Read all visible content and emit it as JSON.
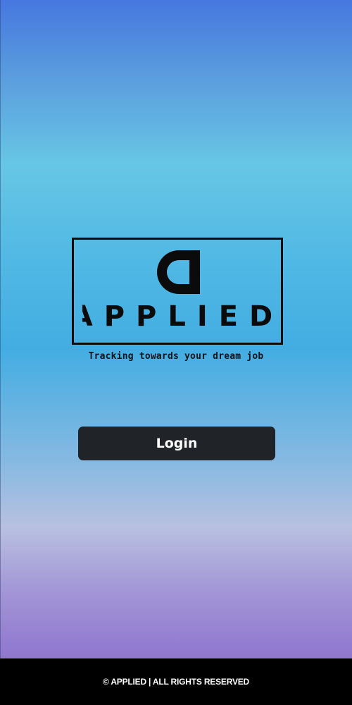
{
  "brand": {
    "name": "APPLIED",
    "tagline": "Tracking towards your dream job"
  },
  "actions": {
    "login_label": "Login"
  },
  "footer": {
    "text": "© APPLIED | ALL RIGHTS RESERVED"
  },
  "colors": {
    "button_bg": "#202327",
    "footer_bg": "#000000",
    "logo_ink": "#0b0b0b"
  }
}
